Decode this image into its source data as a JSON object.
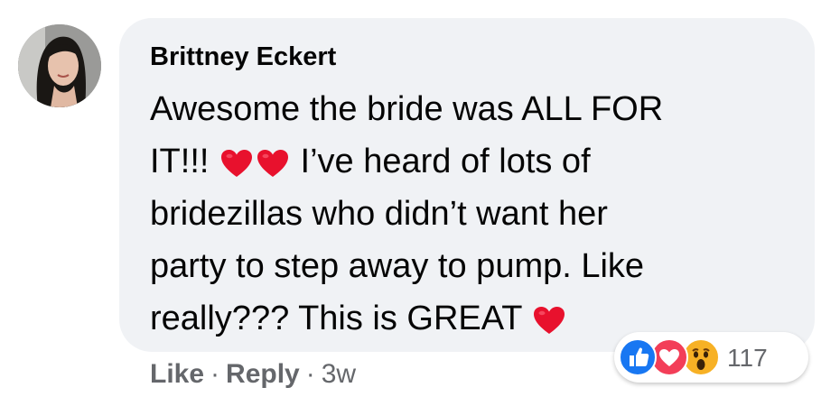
{
  "comment": {
    "author": "Brittney Eckert",
    "lines": [
      {
        "before": "Awesome the bride was ALL FOR",
        "after": ""
      },
      {
        "before": "IT!!! ",
        "after": " I’ve heard of lots of"
      },
      {
        "before": "bridezillas who didn’t want her",
        "after": ""
      },
      {
        "before": "party to step away to pump. Like",
        "after": ""
      },
      {
        "before": "really??? This is GREAT ",
        "after": ""
      }
    ],
    "emoji": "heart",
    "emoji_color": "#e8112d"
  },
  "reactions": {
    "icons": [
      "like-icon",
      "love-icon",
      "wow-icon"
    ],
    "count": "117",
    "colors": {
      "like": "#1877f2",
      "love": "#f33e58",
      "wow": "#f7b125"
    }
  },
  "actions": {
    "like_label": "Like",
    "separator": "·",
    "reply_label": "Reply",
    "timestamp": "3w"
  }
}
